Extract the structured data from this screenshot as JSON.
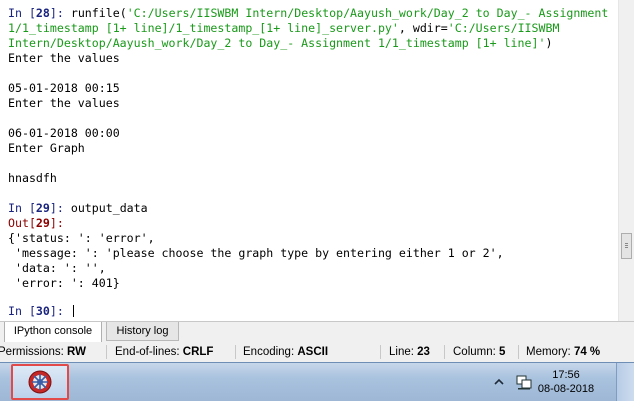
{
  "console": {
    "in28_prompt": "In [",
    "in28_num": "28",
    "in28_close": "]: ",
    "in28_code_a": "runfile(",
    "in28_str_a": "'C:/Users/IISWBM Intern/Desktop/Aayush_work/Day_2 to Day_- Assignment",
    "in28_str_b": "1/1_timestamp [1+ line]/1_timestamp_[1+ line]_server.py'",
    "in28_code_b": ", wdir=",
    "in28_str_c": "'C:/Users/IISWBM",
    "in28_str_d": "Intern/Desktop/Aayush_work/Day_2 to Day_- Assignment 1/1_timestamp [1+ line]'",
    "in28_code_c": ")",
    "out_lines": [
      "Enter the values",
      "",
      "05-01-2018 00:15",
      "Enter the values",
      "",
      "06-01-2018 00:00",
      "Enter Graph",
      "",
      "hnasdfh"
    ],
    "in29_prompt": "In [",
    "in29_num": "29",
    "in29_close": "]: ",
    "in29_code": "output_data",
    "out29_prompt": "Out[",
    "out29_num": "29",
    "out29_close": "]:",
    "dict_lines": [
      "{'status: ': 'error',",
      " 'message: ': 'please choose the graph type by entering either 1 or 2',",
      " 'data: ': '',",
      " 'error: ': 401}"
    ],
    "in30_prompt": "In [",
    "in30_num": "30",
    "in30_close": "]: "
  },
  "tabs": {
    "ipython": "IPython console",
    "history": "History log"
  },
  "status": {
    "permissions_label": "Permissions:",
    "permissions_value": "RW",
    "eol_label": "End-of-lines:",
    "eol_value": "CRLF",
    "encoding_label": "Encoding:",
    "encoding_value": "ASCII",
    "line_label": "Line:",
    "line_value": "23",
    "column_label": "Column:",
    "column_value": "5",
    "memory_label": "Memory:",
    "memory_value": "74 %"
  },
  "taskbar": {
    "time": "17:56",
    "date": "08-08-2018",
    "app_icon": "spyder-icon"
  }
}
